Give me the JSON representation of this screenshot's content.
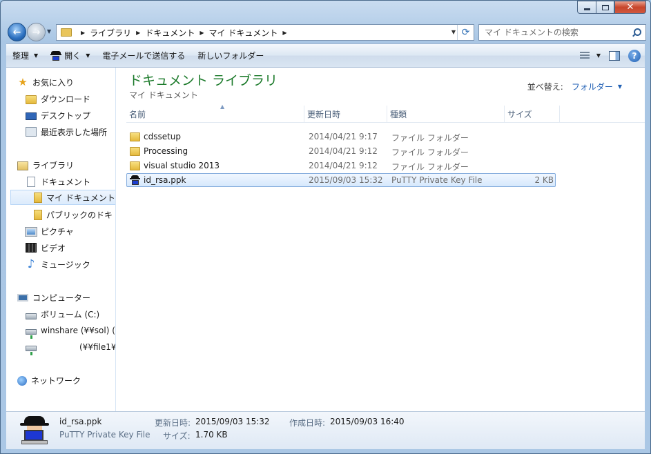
{
  "window": {
    "minimize": "minimize",
    "maximize": "maximize",
    "close": "✕"
  },
  "address": {
    "crumbs": [
      "ライブラリ",
      "ドキュメント",
      "マイ ドキュメント"
    ]
  },
  "search": {
    "placeholder": "マイ ドキュメントの検索"
  },
  "toolbar": {
    "organize": "整理",
    "open": "開く",
    "email": "電子メールで送信する",
    "new_folder": "新しいフォルダー"
  },
  "nav": {
    "favorites": "お気に入り",
    "downloads": "ダウンロード",
    "desktop": "デスクトップ",
    "recent": "最近表示した場所",
    "libraries": "ライブラリ",
    "documents": "ドキュメント",
    "my_documents": "マイ ドキュメント",
    "public_documents": "パブリックのドキ",
    "pictures": "ピクチャ",
    "videos": "ビデオ",
    "music": "ミュージック",
    "computer": "コンピューター",
    "volume_c": "ボリューム (C:)",
    "winshare": "winshare (¥¥sol) (",
    "file1": "(¥¥file1¥",
    "network": "ネットワーク"
  },
  "main": {
    "title": "ドキュメント ライブラリ",
    "subtitle": "マイ ドキュメント",
    "sort_label": "並べ替え:",
    "sort_value": "フォルダー",
    "columns": {
      "name": "名前",
      "date": "更新日時",
      "type": "種類",
      "size": "サイズ"
    },
    "files": [
      {
        "name": "cdssetup",
        "date": "2014/04/21 9:17",
        "type": "ファイル フォルダー",
        "size": "",
        "icon": "folder-icon"
      },
      {
        "name": "Processing",
        "date": "2014/04/21 9:12",
        "type": "ファイル フォルダー",
        "size": "",
        "icon": "folder-icon"
      },
      {
        "name": "visual studio 2013",
        "date": "2014/04/21 9:12",
        "type": "ファイル フォルダー",
        "size": "",
        "icon": "folder-icon"
      },
      {
        "name": "id_rsa.ppk",
        "date": "2015/09/03 15:32",
        "type": "PuTTY Private Key File",
        "size": "2 KB",
        "icon": "putty-key-icon",
        "selected": true
      }
    ]
  },
  "details": {
    "name": "id_rsa.ppk",
    "type": "PuTTY Private Key File",
    "modified_label": "更新日時:",
    "modified_value": "2015/09/03 15:32",
    "created_label": "作成日時:",
    "created_value": "2015/09/03 16:40",
    "size_label": "サイズ:",
    "size_value": "1.70 KB"
  }
}
